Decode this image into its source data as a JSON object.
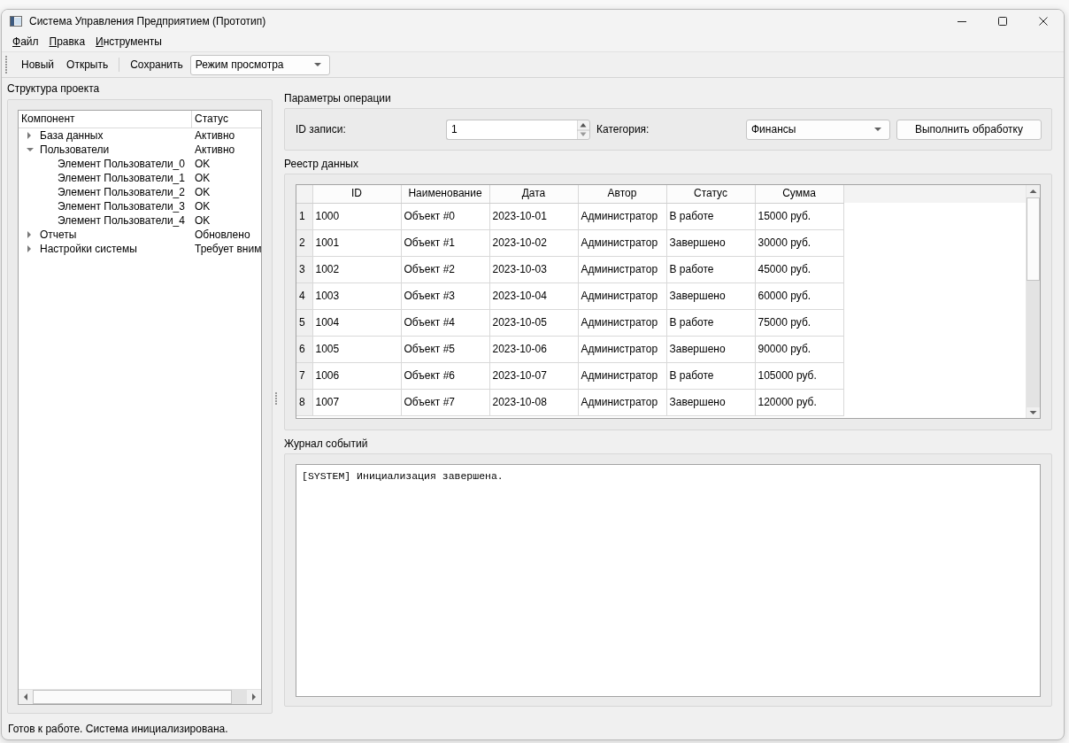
{
  "window": {
    "title": "Система Управления Предприятием (Прототип)"
  },
  "menu": [
    {
      "label": "Файл",
      "shortcut_underlined": true
    },
    {
      "label": "Правка",
      "shortcut_underlined": true
    },
    {
      "label": "Инструменты",
      "shortcut_underlined": true
    }
  ],
  "toolbar": [
    {
      "kind": "button",
      "label": "Новый"
    },
    {
      "kind": "button",
      "label": "Открыть"
    },
    {
      "kind": "separator"
    },
    {
      "kind": "button",
      "label": "Сохранить"
    },
    {
      "kind": "dropdown",
      "value": "Режим просмотра"
    }
  ],
  "project_tree": {
    "title": "Структура проекта",
    "columns": [
      "Компонент",
      "Статус"
    ],
    "items": [
      {
        "label": "База данных",
        "status": "Активно",
        "expanded": false
      },
      {
        "label": "Пользователи",
        "status": "Активно",
        "expanded": true,
        "children": [
          {
            "label": "Элемент Пользователи_0",
            "status": "OK"
          },
          {
            "label": "Элемент Пользователи_1",
            "status": "OK"
          },
          {
            "label": "Элемент Пользователи_2",
            "status": "OK"
          },
          {
            "label": "Элемент Пользователи_3",
            "status": "OK"
          },
          {
            "label": "Элемент Пользователи_4",
            "status": "OK"
          }
        ]
      },
      {
        "label": "Отчеты",
        "status": "Обновлено",
        "expanded": false
      },
      {
        "label": "Настройки системы",
        "status": "Требует вним",
        "expanded": false
      }
    ]
  },
  "operation_params": {
    "title": "Параметры операции",
    "record_id": {
      "label": "ID записи:",
      "value": "1"
    },
    "category": {
      "label": "Категория:",
      "value": "Финансы"
    },
    "run_button": {
      "label": "Выполнить обработку"
    }
  },
  "data_registry": {
    "title": "Реестр данных",
    "columns": [
      "ID",
      "Наименование",
      "Дата",
      "Автор",
      "Статус",
      "Сумма"
    ],
    "rows": [
      {
        "number": "1",
        "cells": [
          "1000",
          "Объект #0",
          "2023-10-01",
          "Администратор",
          "В работе",
          "15000 руб."
        ]
      },
      {
        "number": "2",
        "cells": [
          "1001",
          "Объект #1",
          "2023-10-02",
          "Администратор",
          "Завершено",
          "30000 руб."
        ]
      },
      {
        "number": "3",
        "cells": [
          "1002",
          "Объект #2",
          "2023-10-03",
          "Администратор",
          "В работе",
          "45000 руб."
        ]
      },
      {
        "number": "4",
        "cells": [
          "1003",
          "Объект #3",
          "2023-10-04",
          "Администратор",
          "Завершено",
          "60000 руб."
        ]
      },
      {
        "number": "5",
        "cells": [
          "1004",
          "Объект #4",
          "2023-10-05",
          "Администратор",
          "В работе",
          "75000 руб."
        ]
      },
      {
        "number": "6",
        "cells": [
          "1005",
          "Объект #5",
          "2023-10-06",
          "Администратор",
          "Завершено",
          "90000 руб."
        ]
      },
      {
        "number": "7",
        "cells": [
          "1006",
          "Объект #6",
          "2023-10-07",
          "Администратор",
          "В работе",
          "105000 руб."
        ]
      },
      {
        "number": "8",
        "cells": [
          "1007",
          "Объект #7",
          "2023-10-08",
          "Администратор",
          "Завершено",
          "120000 руб."
        ]
      }
    ]
  },
  "event_log": {
    "title": "Журнал событий",
    "lines": [
      "[SYSTEM] Инициализация завершена."
    ]
  },
  "status_bar": {
    "text": "Готов к работе. Система инициализирована."
  }
}
